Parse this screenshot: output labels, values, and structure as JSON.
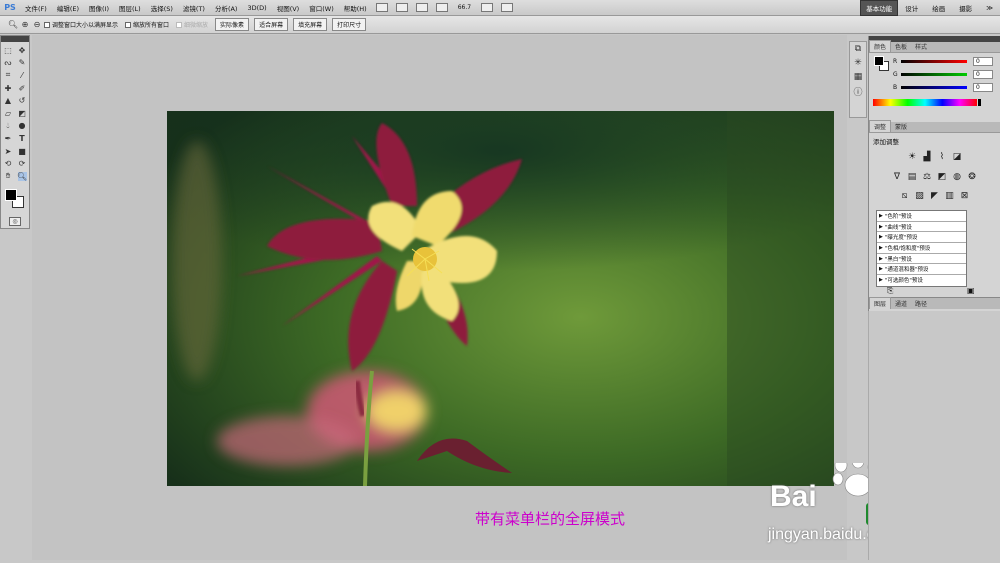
{
  "menubar": {
    "logo": "PS",
    "items": [
      "文件(F)",
      "编辑(E)",
      "图像(I)",
      "图层(L)",
      "选择(S)",
      "滤镜(T)",
      "分析(A)",
      "3D(D)",
      "视图(V)",
      "窗口(W)",
      "帮助(H)"
    ],
    "zoom": "66.7",
    "workspaces": [
      "基本功能",
      "设计",
      "绘画",
      "摄影",
      "≫"
    ]
  },
  "optionsbar": {
    "checkboxes": [
      "调整窗口大小以满屏显示",
      "缩放所有窗口",
      "细微缩放"
    ],
    "buttons": [
      "实际像素",
      "适合屏幕",
      "填充屏幕",
      "打印尺寸"
    ]
  },
  "toolbox": {
    "icons": [
      "marquee-icon",
      "move-icon",
      "lasso-icon",
      "quick-select-icon",
      "crop-icon",
      "eyedropper-icon",
      "healing-icon",
      "brush-icon",
      "stamp-icon",
      "history-brush-icon",
      "eraser-icon",
      "gradient-icon",
      "blur-icon",
      "dodge-icon",
      "pen-icon",
      "type-icon",
      "path-select-icon",
      "shape-icon",
      "3d-rotate-icon",
      "3d-orbit-icon",
      "hand-icon",
      "zoom-icon"
    ]
  },
  "colorpanel": {
    "tabs": [
      "颜色",
      "色板",
      "样式"
    ],
    "rgb": [
      {
        "label": "R",
        "value": "0"
      },
      {
        "label": "G",
        "value": "0"
      },
      {
        "label": "B",
        "value": "0"
      }
    ]
  },
  "adjustments": {
    "tabs": [
      "调整",
      "蒙版"
    ],
    "title": "添加调整",
    "presets": [
      "\"色阶\"预设",
      "\"曲线\"预设",
      "\"曝光度\"预设",
      "\"色相/饱和度\"预设",
      "\"黑白\"预设",
      "\"通道混和器\"预设",
      "\"可选颜色\"预设"
    ]
  },
  "layers": {
    "tabs": [
      "图层",
      "通道",
      "路径"
    ]
  },
  "caption": "带有菜单栏的全屏模式",
  "watermark": {
    "brand": "Bai",
    "brand2": "经验",
    "url": "jingyan.baidu.com"
  }
}
